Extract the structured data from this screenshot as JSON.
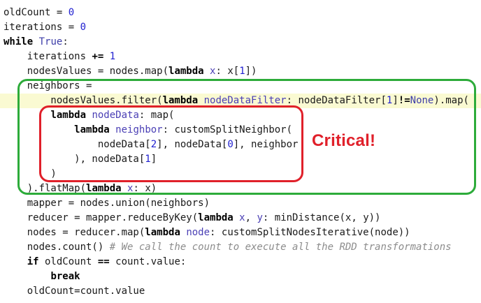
{
  "code": {
    "lines": [
      {
        "tokens": [
          {
            "t": "oldCount = ",
            "c": "plain"
          },
          {
            "t": "0",
            "c": "num"
          }
        ]
      },
      {
        "tokens": [
          {
            "t": "iterations = ",
            "c": "plain"
          },
          {
            "t": "0",
            "c": "num"
          }
        ]
      },
      {
        "tokens": [
          {
            "t": "while",
            "c": "kw"
          },
          {
            "t": " ",
            "c": "plain"
          },
          {
            "t": "True",
            "c": "builtin"
          },
          {
            "t": ":",
            "c": "plain"
          }
        ]
      },
      {
        "tokens": [
          {
            "t": "    iterations ",
            "c": "plain"
          },
          {
            "t": "+=",
            "c": "kw"
          },
          {
            "t": " ",
            "c": "plain"
          },
          {
            "t": "1",
            "c": "num"
          }
        ]
      },
      {
        "tokens": [
          {
            "t": "    nodesValues = nodes.map(",
            "c": "plain"
          },
          {
            "t": "lambda",
            "c": "kw"
          },
          {
            "t": " ",
            "c": "plain"
          },
          {
            "t": "x",
            "c": "param"
          },
          {
            "t": ": x[",
            "c": "plain"
          },
          {
            "t": "1",
            "c": "num"
          },
          {
            "t": "])",
            "c": "plain"
          }
        ]
      },
      {
        "tokens": [
          {
            "t": "    neighbors =",
            "c": "plain"
          }
        ]
      },
      {
        "highlight": true,
        "tokens": [
          {
            "t": "        nodesValues.filter(",
            "c": "plain"
          },
          {
            "t": "lambda",
            "c": "kw"
          },
          {
            "t": " ",
            "c": "plain"
          },
          {
            "t": "nodeDataFilter",
            "c": "param"
          },
          {
            "t": ": nodeDataFilter[",
            "c": "plain"
          },
          {
            "t": "1",
            "c": "num"
          },
          {
            "t": "]",
            "c": "plain"
          },
          {
            "t": "!=",
            "c": "kw"
          },
          {
            "t": "None",
            "c": "builtin"
          },
          {
            "t": ").map(",
            "c": "plain"
          }
        ]
      },
      {
        "tokens": [
          {
            "t": "        ",
            "c": "plain"
          },
          {
            "t": "lambda",
            "c": "kw"
          },
          {
            "t": " ",
            "c": "plain"
          },
          {
            "t": "nodeData",
            "c": "param"
          },
          {
            "t": ": map(",
            "c": "plain"
          }
        ]
      },
      {
        "tokens": [
          {
            "t": "            ",
            "c": "plain"
          },
          {
            "t": "lambda",
            "c": "kw"
          },
          {
            "t": " ",
            "c": "plain"
          },
          {
            "t": "neighbor",
            "c": "param"
          },
          {
            "t": ": customSplitNeighbor(",
            "c": "plain"
          }
        ]
      },
      {
        "tokens": [
          {
            "t": "                nodeData[",
            "c": "plain"
          },
          {
            "t": "2",
            "c": "num"
          },
          {
            "t": "], nodeData[",
            "c": "plain"
          },
          {
            "t": "0",
            "c": "num"
          },
          {
            "t": "], neighbor",
            "c": "plain"
          }
        ]
      },
      {
        "tokens": [
          {
            "t": "            ), nodeData[",
            "c": "plain"
          },
          {
            "t": "1",
            "c": "num"
          },
          {
            "t": "]",
            "c": "plain"
          }
        ]
      },
      {
        "tokens": [
          {
            "t": "        )",
            "c": "plain"
          }
        ]
      },
      {
        "tokens": [
          {
            "t": "    ).flatMap(",
            "c": "plain"
          },
          {
            "t": "lambda",
            "c": "kw"
          },
          {
            "t": " ",
            "c": "plain"
          },
          {
            "t": "x",
            "c": "param"
          },
          {
            "t": ": x)",
            "c": "plain"
          }
        ]
      },
      {
        "tokens": [
          {
            "t": "    mapper = nodes.union(neighbors)",
            "c": "plain"
          }
        ]
      },
      {
        "tokens": [
          {
            "t": "    reducer = mapper.reduceByKey(",
            "c": "plain"
          },
          {
            "t": "lambda",
            "c": "kw"
          },
          {
            "t": " ",
            "c": "plain"
          },
          {
            "t": "x",
            "c": "param"
          },
          {
            "t": ", ",
            "c": "plain"
          },
          {
            "t": "y",
            "c": "param"
          },
          {
            "t": ": minDistance(x, y))",
            "c": "plain"
          }
        ]
      },
      {
        "tokens": [
          {
            "t": "    nodes = reducer.map(",
            "c": "plain"
          },
          {
            "t": "lambda",
            "c": "kw"
          },
          {
            "t": " ",
            "c": "plain"
          },
          {
            "t": "node",
            "c": "param"
          },
          {
            "t": ": customSplitNodesIterative(node))",
            "c": "plain"
          }
        ]
      },
      {
        "tokens": [
          {
            "t": "    nodes.count() ",
            "c": "plain"
          },
          {
            "t": "# We call the count to execute all the RDD transformations",
            "c": "comment"
          }
        ]
      },
      {
        "tokens": [
          {
            "t": "    ",
            "c": "plain"
          },
          {
            "t": "if",
            "c": "kw"
          },
          {
            "t": " oldCount ",
            "c": "plain"
          },
          {
            "t": "==",
            "c": "kw"
          },
          {
            "t": " count.value:",
            "c": "plain"
          }
        ]
      },
      {
        "tokens": [
          {
            "t": "        ",
            "c": "plain"
          },
          {
            "t": "break",
            "c": "kw"
          }
        ]
      },
      {
        "tokens": [
          {
            "t": "    oldCount=count.value",
            "c": "plain"
          }
        ]
      }
    ]
  },
  "annotations": {
    "callout_text": "Critical!",
    "outer_box_color": "#2dab3a",
    "inner_box_color": "#e0202a"
  }
}
